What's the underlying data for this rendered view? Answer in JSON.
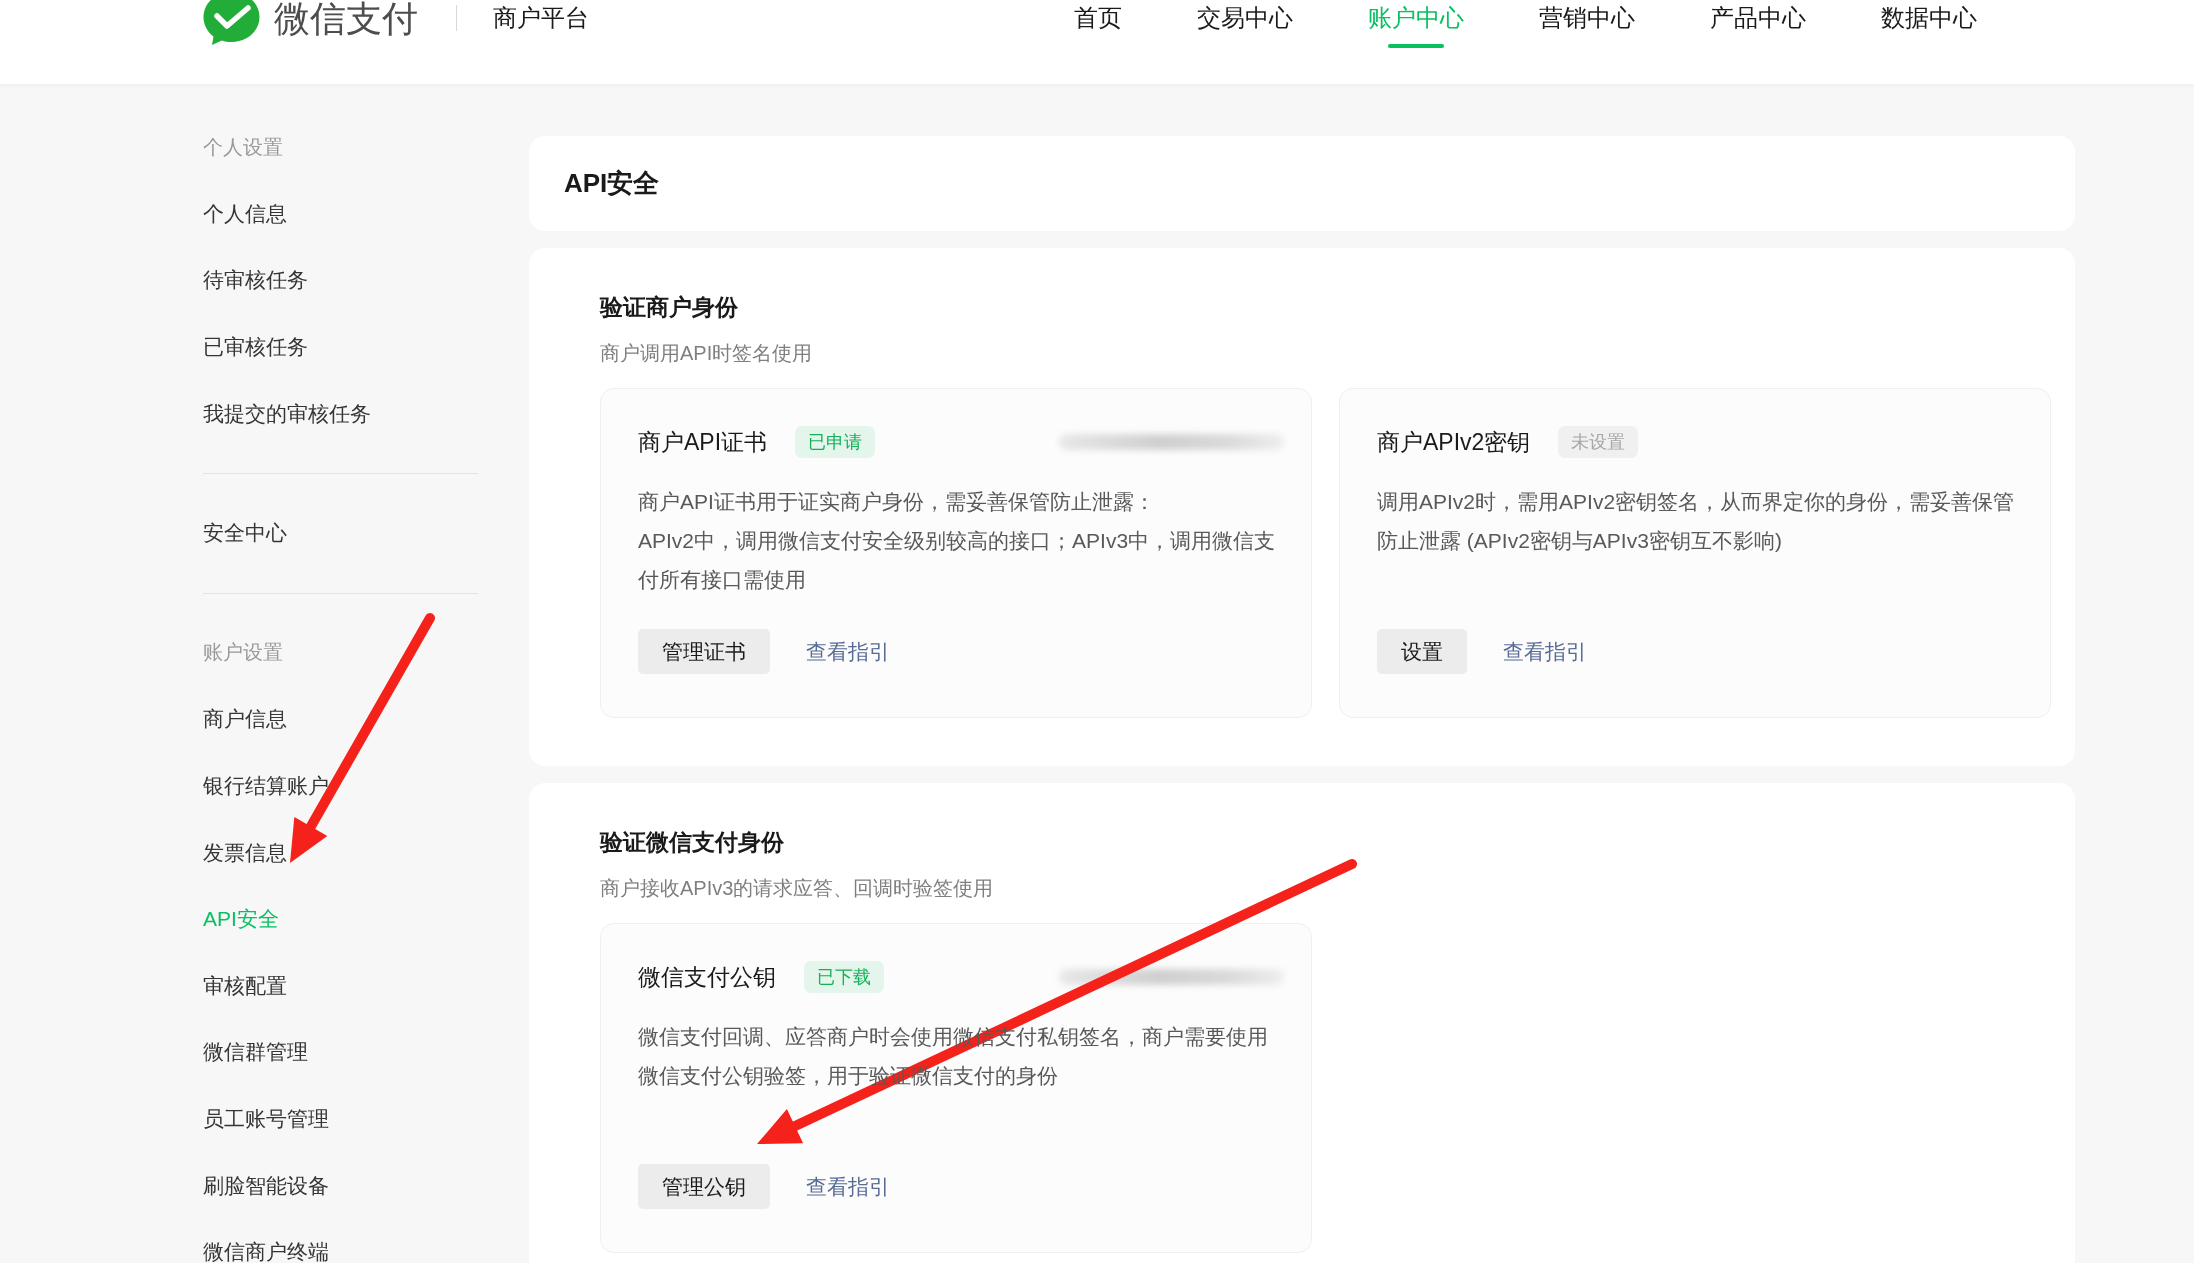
{
  "header": {
    "brand": "微信支付",
    "product": "商户平台",
    "nav": [
      {
        "label": "首页",
        "selected": false
      },
      {
        "label": "交易中心",
        "selected": false
      },
      {
        "label": "账户中心",
        "selected": true
      },
      {
        "label": "营销中心",
        "selected": false
      },
      {
        "label": "产品中心",
        "selected": false
      },
      {
        "label": "数据中心",
        "selected": false
      }
    ]
  },
  "sidebar": {
    "groups": [
      {
        "heading": "个人设置",
        "items": [
          {
            "label": "个人信息",
            "selected": false
          },
          {
            "label": "待审核任务",
            "selected": false
          },
          {
            "label": "已审核任务",
            "selected": false
          },
          {
            "label": "我提交的审核任务",
            "selected": false
          }
        ]
      },
      {
        "items": [
          {
            "label": "安全中心",
            "selected": false
          }
        ]
      },
      {
        "heading": "账户设置",
        "items": [
          {
            "label": "商户信息",
            "selected": false
          },
          {
            "label": "银行结算账户",
            "selected": false
          },
          {
            "label": "发票信息",
            "selected": false
          },
          {
            "label": "API安全",
            "selected": true
          },
          {
            "label": "审核配置",
            "selected": false
          },
          {
            "label": "微信群管理",
            "selected": false
          },
          {
            "label": "员工账号管理",
            "selected": false
          },
          {
            "label": "刷脸智能设备",
            "selected": false
          },
          {
            "label": "微信商户终端",
            "selected": false
          }
        ]
      }
    ]
  },
  "page_title": "API安全",
  "sections": [
    {
      "title": "验证商户身份",
      "subtitle": "商户调用API时签名使用",
      "cards": [
        {
          "title": "商户API证书",
          "badge": {
            "label": "已申请",
            "kind": "success"
          },
          "redacted": true,
          "description": [
            "商户API证书用于证实商户身份，需妥善保管防止泄露：",
            "APIv2中，调用微信支付安全级别较高的接口；APIv3中，调用微信支付所有接口需使用"
          ],
          "button": "管理证书",
          "link": "查看指引"
        },
        {
          "title": "商户APIv2密钥",
          "badge": {
            "label": "未设置",
            "kind": "muted"
          },
          "redacted": false,
          "description": [
            "调用APIv2时，需用APIv2密钥签名，从而界定你的身份，需妥善保管防止泄露 (APIv2密钥与APIv3密钥互不影响)"
          ],
          "button": "设置",
          "link": "查看指引"
        }
      ]
    },
    {
      "title": "验证微信支付身份",
      "subtitle": "商户接收APIv3的请求应答、回调时验签使用",
      "cards": [
        {
          "title": "微信支付公钥",
          "badge": {
            "label": "已下载",
            "kind": "success"
          },
          "redacted": true,
          "description": [
            "微信支付回调、应答商户时会使用微信支付私钥签名，商户需要使用微信支付公钥验签，用于验证微信支付的身份"
          ],
          "button": "管理公钥",
          "link": "查看指引"
        }
      ]
    }
  ]
}
